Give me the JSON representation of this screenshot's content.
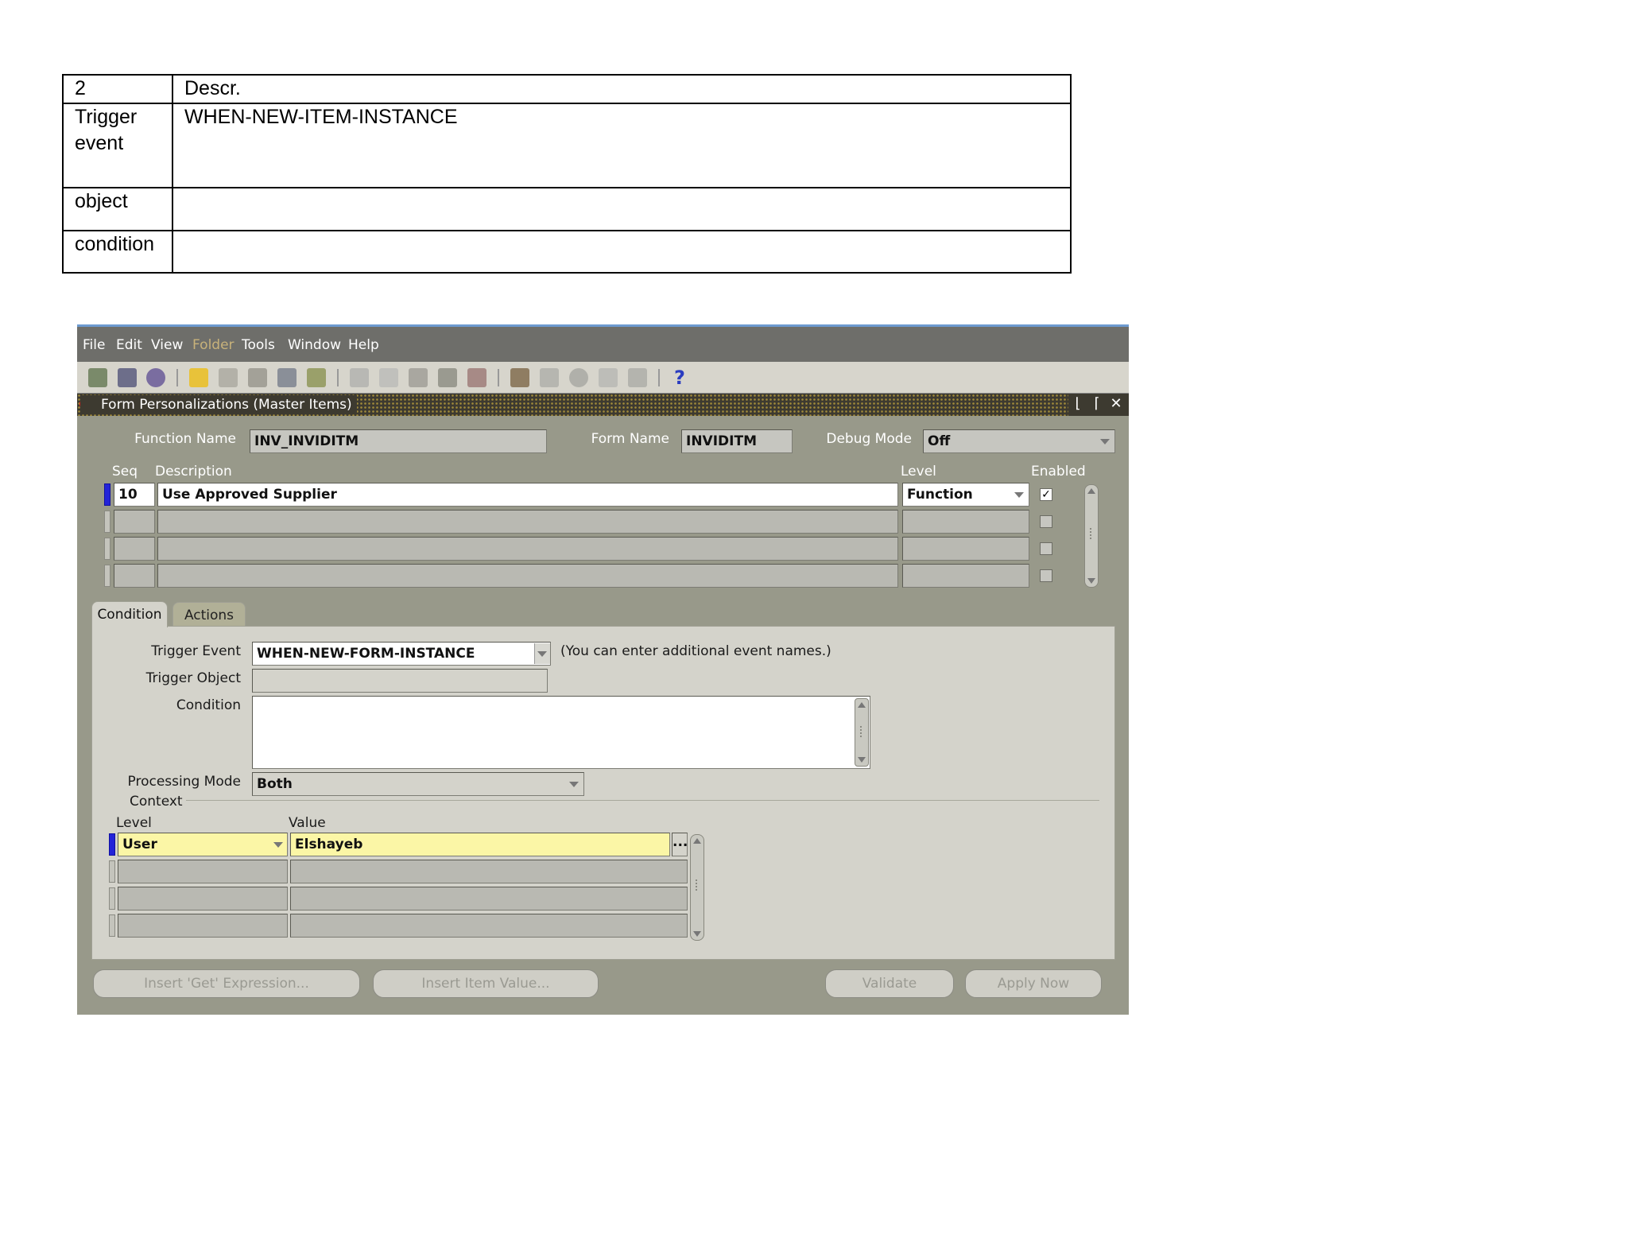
{
  "doc_table": {
    "rows": [
      {
        "label": "2",
        "value": "Descr."
      },
      {
        "label": "Trigger event",
        "value": "WHEN-NEW-ITEM-INSTANCE"
      },
      {
        "label": "object",
        "value": ""
      },
      {
        "label": "condition",
        "value": ""
      }
    ]
  },
  "app": {
    "menu": [
      "File",
      "Edit",
      "View",
      "Folder",
      "Tools",
      "Window",
      "Help"
    ],
    "window_title": "Form Personalizations (Master Items)",
    "header": {
      "function_name_label": "Function Name",
      "function_name": "INV_INVIDITM",
      "form_name_label": "Form Name",
      "form_name": "INVIDITM",
      "debug_mode_label": "Debug Mode",
      "debug_mode": "Off"
    },
    "rules": {
      "columns": {
        "seq": "Seq",
        "description": "Description",
        "level": "Level",
        "enabled": "Enabled"
      },
      "rows": [
        {
          "seq": "10",
          "description": "Use Approved Supplier",
          "level": "Function",
          "enabled": true
        },
        {
          "seq": "",
          "description": "",
          "level": "",
          "enabled": false
        },
        {
          "seq": "",
          "description": "",
          "level": "",
          "enabled": false
        },
        {
          "seq": "",
          "description": "",
          "level": "",
          "enabled": false
        }
      ]
    },
    "tabs": [
      "Condition",
      "Actions"
    ],
    "condition": {
      "trigger_event_label": "Trigger Event",
      "trigger_event": "WHEN-NEW-FORM-INSTANCE",
      "trigger_event_hint": "(You can enter additional event names.)",
      "trigger_object_label": "Trigger Object",
      "trigger_object": "",
      "condition_label": "Condition",
      "condition": "",
      "processing_mode_label": "Processing Mode",
      "processing_mode": "Both",
      "context_label": "Context",
      "context_columns": {
        "level": "Level",
        "value": "Value"
      },
      "context_rows": [
        {
          "level": "User",
          "value": "Elshayeb"
        },
        {
          "level": "",
          "value": ""
        },
        {
          "level": "",
          "value": ""
        },
        {
          "level": "",
          "value": ""
        }
      ],
      "lov_button": "..."
    },
    "buttons": {
      "insert_get": "Insert 'Get' Expression...",
      "insert_item": "Insert Item Value...",
      "validate": "Validate",
      "apply_now": "Apply Now"
    },
    "icons": [
      "new-icon",
      "find-icon",
      "navigate-icon",
      "save-icon",
      "next-step-icon",
      "switch-responsibility-icon",
      "print-icon",
      "close-form-icon",
      "cut-icon",
      "copy-icon",
      "paste-icon",
      "new-record-icon",
      "delete-record-icon",
      "edit-field-icon",
      "zoom-icon",
      "translations-icon",
      "attachments-icon",
      "folder-tools-icon",
      "help-icon"
    ]
  }
}
